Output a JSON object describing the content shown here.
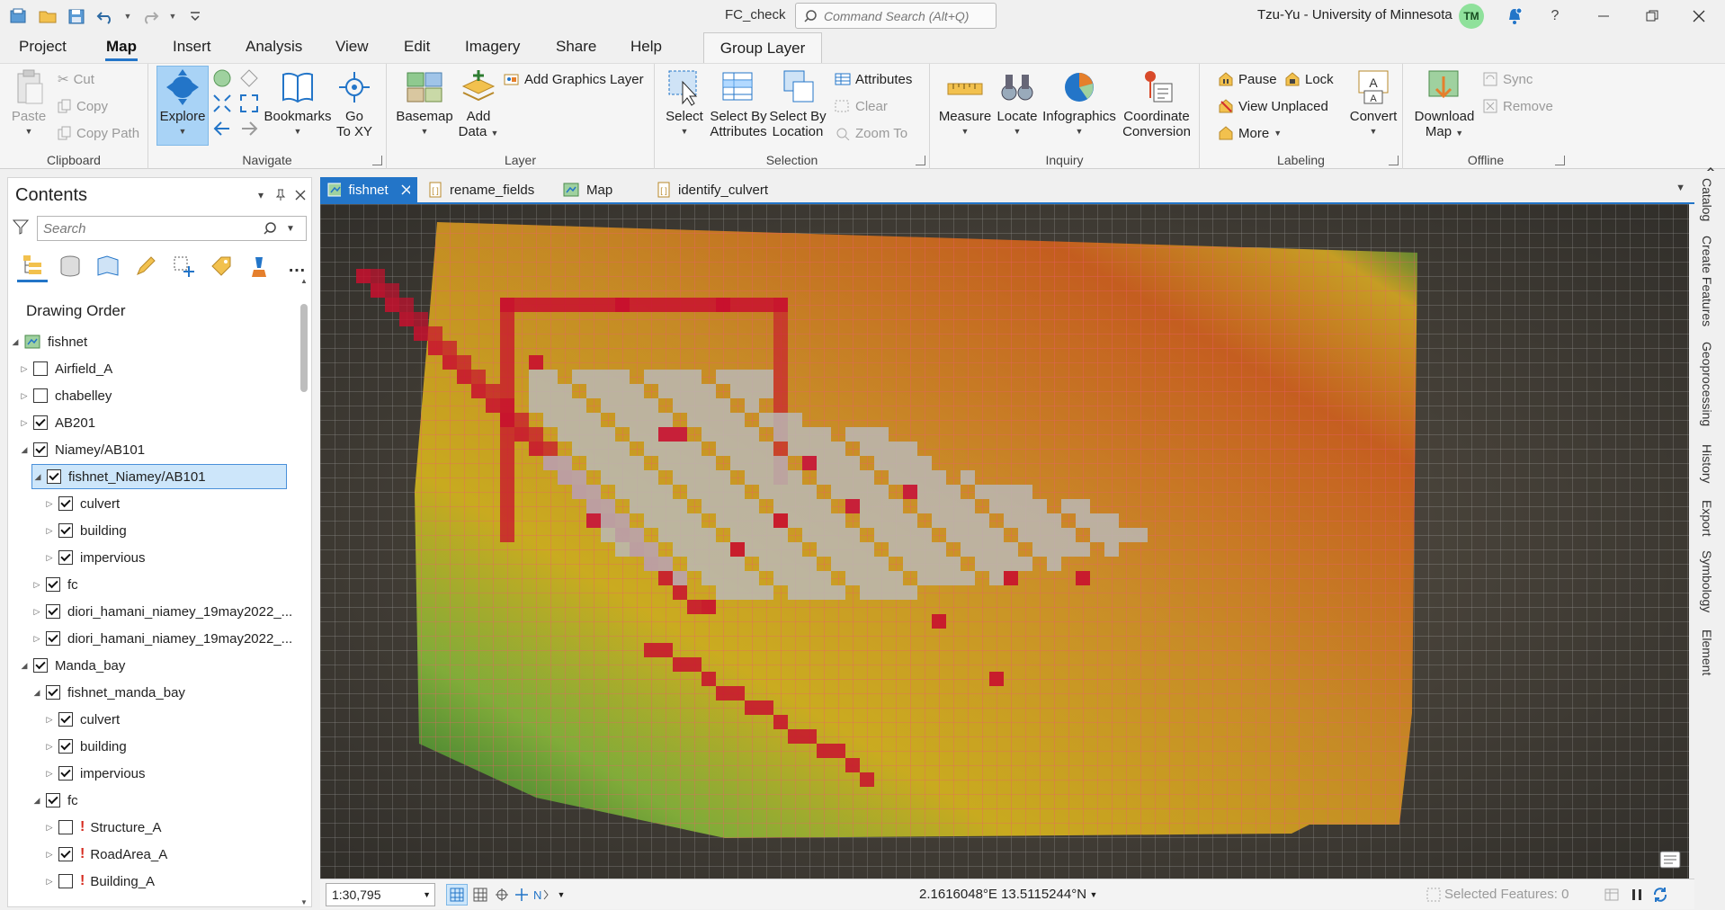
{
  "title_bar": {
    "document_title": "FC_check",
    "command_search_placeholder": "Command Search (Alt+Q)",
    "user": "Tzu-Yu - University of Minnesota",
    "avatar_initials": "TM"
  },
  "ribbon_tabs": [
    "Project",
    "Map",
    "Insert",
    "Analysis",
    "View",
    "Edit",
    "Imagery",
    "Share",
    "Help"
  ],
  "context_tab": "Group Layer",
  "active_tab": "Map",
  "ribbon": {
    "clipboard": {
      "label": "Clipboard",
      "paste": "Paste",
      "cut": "Cut",
      "copy": "Copy",
      "copy_path": "Copy Path"
    },
    "navigate": {
      "label": "Navigate",
      "explore": "Explore",
      "bookmarks": "Bookmarks",
      "go_to_xy_1": "Go",
      "go_to_xy_2": "To XY"
    },
    "layer": {
      "label": "Layer",
      "basemap": "Basemap",
      "add_data_1": "Add",
      "add_data_2": "Data",
      "add_graphics_layer": "Add Graphics Layer"
    },
    "selection": {
      "label": "Selection",
      "select": "Select",
      "select_by_attributes_1": "Select By",
      "select_by_attributes_2": "Attributes",
      "select_by_location_1": "Select By",
      "select_by_location_2": "Location",
      "attributes": "Attributes",
      "clear": "Clear",
      "zoom_to": "Zoom To"
    },
    "inquiry": {
      "label": "Inquiry",
      "measure": "Measure",
      "locate": "Locate",
      "infographics": "Infographics",
      "coordinate_1": "Coordinate",
      "coordinate_2": "Conversion"
    },
    "labeling": {
      "label": "Labeling",
      "pause": "Pause",
      "lock": "Lock",
      "view_unplaced": "View Unplaced",
      "more": "More",
      "convert": "Convert"
    },
    "offline": {
      "label": "Offline",
      "download_1": "Download",
      "download_2": "Map",
      "sync": "Sync",
      "remove": "Remove"
    }
  },
  "contents": {
    "title": "Contents",
    "search_placeholder": "Search",
    "drawing_order": "Drawing Order",
    "tree": [
      {
        "label": "fishnet",
        "level": 0,
        "expanded": true,
        "checkbox": false,
        "icon": "map-icon"
      },
      {
        "label": "Airfield_A",
        "level": 1,
        "expanded": false,
        "checked": false
      },
      {
        "label": "chabelley",
        "level": 1,
        "expanded": false,
        "checked": false
      },
      {
        "label": "AB201",
        "level": 1,
        "expanded": false,
        "checked": true
      },
      {
        "label": "Niamey/AB101",
        "level": 1,
        "expanded": true,
        "checked": true
      },
      {
        "label": "fishnet_Niamey/AB101",
        "level": 2,
        "expanded": true,
        "checked": true,
        "selected": true
      },
      {
        "label": "culvert",
        "level": 3,
        "expanded": false,
        "checked": true
      },
      {
        "label": "building",
        "level": 3,
        "expanded": false,
        "checked": true
      },
      {
        "label": "impervious",
        "level": 3,
        "expanded": false,
        "checked": true
      },
      {
        "label": "fc",
        "level": 2,
        "expanded": false,
        "checked": true
      },
      {
        "label": "diori_hamani_niamey_19may2022_...",
        "level": 2,
        "expanded": false,
        "checked": true
      },
      {
        "label": "diori_hamani_niamey_19may2022_...",
        "level": 2,
        "expanded": false,
        "checked": true
      },
      {
        "label": "Manda_bay",
        "level": 1,
        "expanded": true,
        "checked": true
      },
      {
        "label": "fishnet_manda_bay",
        "level": 2,
        "expanded": true,
        "checked": true
      },
      {
        "label": "culvert",
        "level": 3,
        "expanded": false,
        "checked": true
      },
      {
        "label": "building",
        "level": 3,
        "expanded": false,
        "checked": true
      },
      {
        "label": "impervious",
        "level": 3,
        "expanded": false,
        "checked": true
      },
      {
        "label": "fc",
        "level": 2,
        "expanded": true,
        "checked": true
      },
      {
        "label": "Structure_A",
        "level": 3,
        "expanded": false,
        "checked": false,
        "warning": true
      },
      {
        "label": "RoadArea_A",
        "level": 3,
        "expanded": false,
        "checked": true,
        "warning": true
      },
      {
        "label": "Building_A",
        "level": 3,
        "expanded": false,
        "checked": false,
        "warning": true
      }
    ]
  },
  "doc_tabs": [
    {
      "label": "fishnet",
      "active": true,
      "icon": "map-icon",
      "closable": true
    },
    {
      "label": "rename_fields",
      "active": false,
      "icon": "notebook-icon"
    },
    {
      "label": "Map",
      "active": false,
      "icon": "map-icon"
    },
    {
      "label": "identify_culvert",
      "active": false,
      "icon": "notebook-icon"
    }
  ],
  "status_bar": {
    "scale": "1:30,795",
    "coordinates": "2.1616048°E 13.5115244°N",
    "selected_features": "Selected Features: 0"
  },
  "dock_tabs": [
    "Catalog",
    "Create Features",
    "Geoprocessing",
    "History",
    "Export",
    "Symbology",
    "Element"
  ],
  "colors": {
    "accent": "#2375c8",
    "grid_line": "#e8566a",
    "cell_red": "#c8102e",
    "cell_gray": "#b9b9b9",
    "gradient_start": "#1f7a2e",
    "gradient_mid": "#e6c21a",
    "gradient_end": "#e0641a"
  }
}
